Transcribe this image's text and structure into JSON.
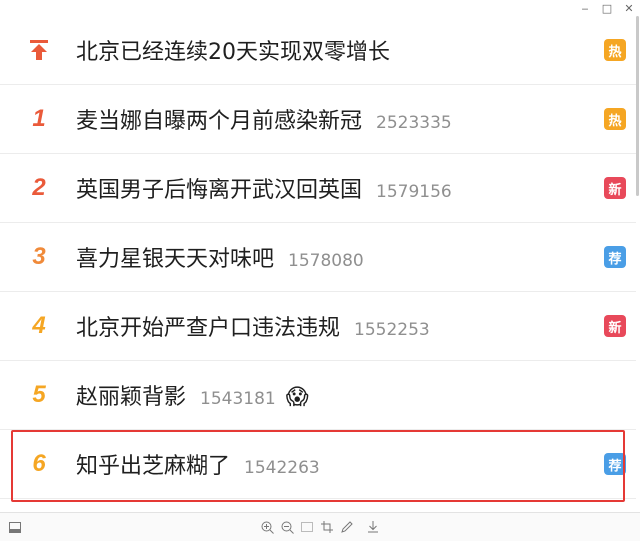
{
  "window": {
    "minimize_glyph": "‒",
    "maximize_glyph": "□",
    "close_glyph": "✕"
  },
  "hot_list": [
    {
      "rank": "",
      "rank_icon": "pin-top-icon",
      "title": "北京已经连续20天实现双零增长",
      "count": "",
      "tag": "热",
      "tag_type": "hot"
    },
    {
      "rank": "1",
      "title": "麦当娜自曝两个月前感染新冠",
      "count": "2523335",
      "tag": "热",
      "tag_type": "hot"
    },
    {
      "rank": "2",
      "title": "英国男子后悔离开武汉回英国",
      "count": "1579156",
      "tag": "新",
      "tag_type": "new"
    },
    {
      "rank": "3",
      "title": "喜力星银天天对味吧",
      "count": "1578080",
      "tag": "荐",
      "tag_type": "rec"
    },
    {
      "rank": "4",
      "title": "北京开始严查户口违法违规",
      "count": "1552253",
      "tag": "新",
      "tag_type": "new"
    },
    {
      "rank": "5",
      "title": "赵丽颖背影",
      "count": "1543181",
      "emoji": "😱",
      "tag": "",
      "tag_type": ""
    },
    {
      "rank": "6",
      "title": "知乎出芝麻糊了",
      "count": "1542263",
      "tag": "荐",
      "tag_type": "rec"
    }
  ],
  "toolbar": {
    "icons": [
      "sidebar-icon",
      "zoom-in-icon",
      "zoom-out-icon",
      "fit-icon",
      "crop-icon",
      "edit-icon",
      "download-icon"
    ]
  },
  "colors": {
    "accent_red": "#e53935",
    "rank_top": "#ea5a3a",
    "rank_mid": "#f08a3a",
    "rank_low": "#f5a623",
    "tag_hot": "#f5a623",
    "tag_new": "#e8495a",
    "tag_rec": "#4a9ee6"
  }
}
